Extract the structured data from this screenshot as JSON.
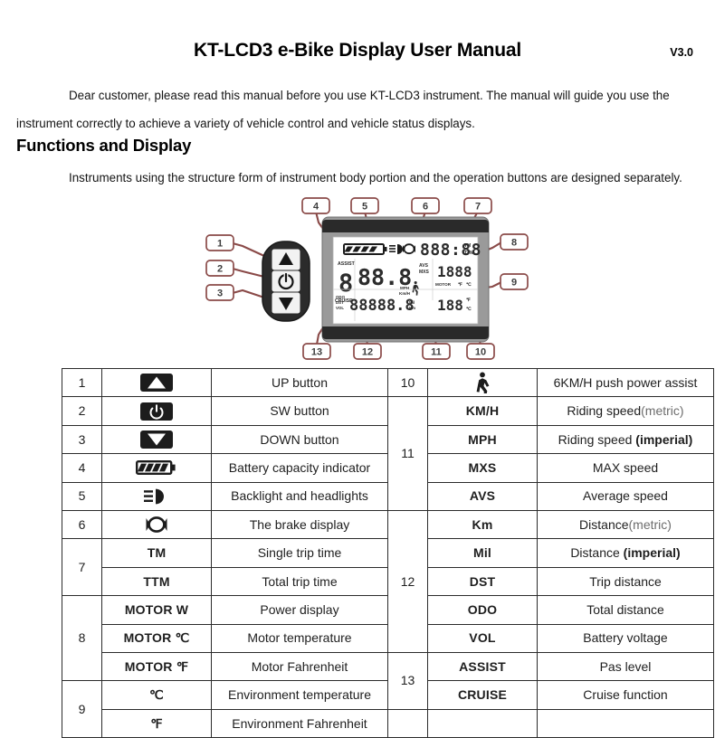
{
  "header": {
    "title": "KT-LCD3 e-Bike Display User Manual",
    "version": "V3.0"
  },
  "intro": {
    "paragraph": "Dear customer, please read this manual before you use KT-LCD3 instrument. The manual will guide you use the instrument correctly to achieve a variety of vehicle control and vehicle status displays."
  },
  "section": {
    "heading": "Functions and Display",
    "paragraph": "Instruments using the structure form of instrument body portion and the operation buttons are designed separately."
  },
  "diagram": {
    "callouts_top": [
      "4",
      "5",
      "6",
      "7"
    ],
    "callouts_left": [
      "1",
      "2",
      "3"
    ],
    "callouts_right": [
      "8",
      "9"
    ],
    "callouts_bottom": [
      "13",
      "12",
      "11",
      "10"
    ],
    "lcd": {
      "clock": "888:88",
      "clock_labels": [
        "TM",
        "TTM"
      ],
      "assist_label": "ASSIST",
      "assist_value": "8",
      "cruise_label": "CRUISE",
      "speed_value": "88.8",
      "speed_units": [
        "MPH",
        "Km/H"
      ],
      "avs_mxs": [
        "AVS",
        "MXS"
      ],
      "motor_value": "1888",
      "motor_label": "MOTOR",
      "motor_units": [
        "℉",
        "℃"
      ],
      "bottom_labels": [
        "ODO",
        "DST",
        "VOL"
      ],
      "bottom_value": "88888.8",
      "bottom_units": [
        "Mil",
        "Km"
      ],
      "temp_value": "188",
      "temp_units": [
        "℉",
        "℃"
      ]
    }
  },
  "table": {
    "left": [
      {
        "num": "1",
        "num_rowspan": 1,
        "sym_icon": "up-triangle-button-icon",
        "sym": "",
        "desc": "UP button"
      },
      {
        "num": "2",
        "num_rowspan": 1,
        "sym_icon": "power-button-icon",
        "sym": "",
        "desc": "SW button"
      },
      {
        "num": "3",
        "num_rowspan": 1,
        "sym_icon": "down-triangle-button-icon",
        "sym": "",
        "desc": "DOWN button"
      },
      {
        "num": "4",
        "num_rowspan": 1,
        "sym_icon": "battery-icon",
        "sym": "",
        "desc": "Battery capacity indicator"
      },
      {
        "num": "5",
        "num_rowspan": 1,
        "sym_icon": "headlight-icon",
        "sym": "",
        "desc": "Backlight and headlights"
      },
      {
        "num": "6",
        "num_rowspan": 1,
        "sym_icon": "brake-icon",
        "sym": "",
        "desc": "The brake display"
      },
      {
        "num": "7",
        "num_rowspan": 2,
        "sym_icon": "",
        "sym": "TM",
        "desc": "Single trip time"
      },
      {
        "num": "",
        "num_rowspan": 0,
        "sym_icon": "",
        "sym": "TTM",
        "desc": "Total trip time"
      },
      {
        "num": "8",
        "num_rowspan": 3,
        "sym_icon": "",
        "sym": "MOTOR W",
        "desc": "Power display"
      },
      {
        "num": "",
        "num_rowspan": 0,
        "sym_icon": "",
        "sym": "MOTOR ℃",
        "desc": "Motor temperature"
      },
      {
        "num": "",
        "num_rowspan": 0,
        "sym_icon": "",
        "sym": "MOTOR ℉",
        "desc": "Motor Fahrenheit"
      },
      {
        "num": "9",
        "num_rowspan": 2,
        "sym_icon": "",
        "sym": "℃",
        "desc": "Environment temperature"
      },
      {
        "num": "",
        "num_rowspan": 0,
        "sym_icon": "",
        "sym": "℉",
        "desc": "Environment Fahrenheit"
      }
    ],
    "right": [
      {
        "num": "10",
        "num_rowspan": 1,
        "sym_icon": "walking-person-icon",
        "sym": "",
        "desc": "6KM/H push power assist",
        "desc_plain": "6KM/H push power assist"
      },
      {
        "num": "11",
        "num_rowspan": 4,
        "sym_icon": "",
        "sym": "KM/H",
        "desc_pre": "Riding speed",
        "desc_paren_muted": "(metric)"
      },
      {
        "num": "",
        "num_rowspan": 0,
        "sym_icon": "",
        "sym": "MPH",
        "desc_pre": "Riding speed ",
        "desc_paren_bold": "(imperial)"
      },
      {
        "num": "",
        "num_rowspan": 0,
        "sym_icon": "",
        "sym": "MXS",
        "desc_plain": "MAX speed"
      },
      {
        "num": "",
        "num_rowspan": 0,
        "sym_icon": "",
        "sym": "AVS",
        "desc_plain": "Average speed"
      },
      {
        "num": "12",
        "num_rowspan": 5,
        "sym_icon": "",
        "sym": "Km",
        "desc_pre": "Distance",
        "desc_paren_muted": "(metric)"
      },
      {
        "num": "",
        "num_rowspan": 0,
        "sym_icon": "",
        "sym": "Mil",
        "desc_pre": "Distance ",
        "desc_paren_bold": "(imperial)"
      },
      {
        "num": "",
        "num_rowspan": 0,
        "sym_icon": "",
        "sym": "DST",
        "desc_plain": "Trip distance"
      },
      {
        "num": "",
        "num_rowspan": 0,
        "sym_icon": "",
        "sym": "ODO",
        "desc_plain": "Total distance"
      },
      {
        "num": "",
        "num_rowspan": 0,
        "sym_icon": "",
        "sym": "VOL",
        "desc_plain": "Battery voltage"
      },
      {
        "num": "13",
        "num_rowspan": 2,
        "sym_icon": "",
        "sym": "ASSIST",
        "desc_plain": "Pas level"
      },
      {
        "num": "",
        "num_rowspan": 0,
        "sym_icon": "",
        "sym": "CRUISE",
        "desc_plain": "Cruise function"
      },
      {
        "num": "",
        "num_rowspan": 1,
        "sym_icon": "",
        "sym": "",
        "desc_plain": ""
      }
    ]
  },
  "colors": {
    "callout_stroke": "#8a4a48",
    "table_border": "#2b2b2b",
    "text": "#1a1a1a",
    "muted": "#6d6d6d",
    "lcd_bg": "#ffffff",
    "bezel": "#8d8d8d",
    "bezel_dark": "#2e2e2e"
  }
}
